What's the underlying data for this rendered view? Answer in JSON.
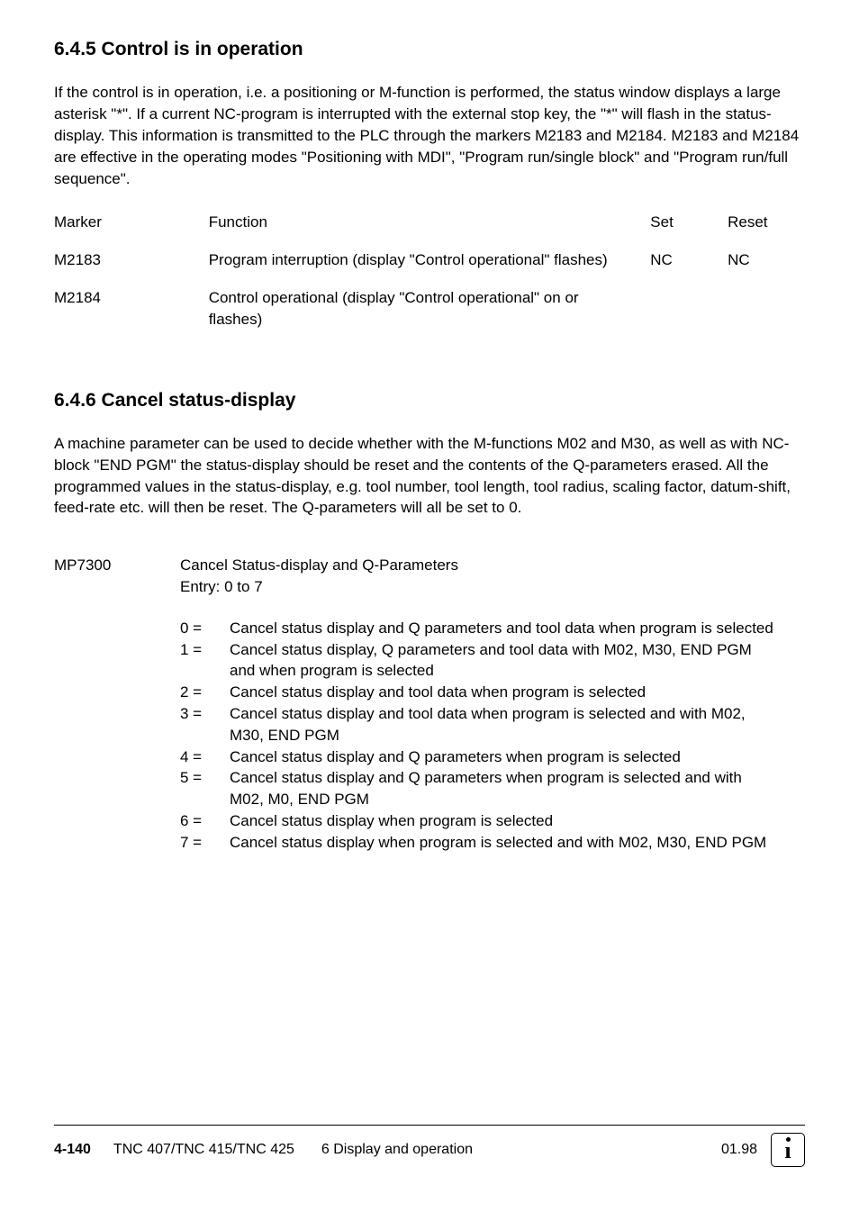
{
  "section1": {
    "heading": "6.4.5  Control is in operation",
    "paragraph": "If the control is in operation, i.e. a positioning or M-function is performed, the status window displays a large asterisk \"*\".  If a current NC-program is interrupted with the external stop key, the \"*\" will flash in the status-display. This information is transmitted to the PLC through the markers M2183 and M2184.  M2183 and M2184 are effective in the operating modes \"Positioning with MDI\", \"Program run/single block\" and \"Program run/full sequence\".",
    "table": {
      "headers": {
        "marker": "Marker",
        "function": "Function",
        "set": "Set",
        "reset": "Reset"
      },
      "rows": [
        {
          "marker": "M2183",
          "function": "Program interruption (display \"Control operational\" flashes)",
          "set": "NC",
          "reset": "NC"
        },
        {
          "marker": "M2184",
          "function": "Control operational (display \"Control operational\" on or flashes)",
          "set": "",
          "reset": ""
        }
      ]
    }
  },
  "section2": {
    "heading": "6.4.6  Cancel status-display",
    "paragraph": "A machine parameter can be used to decide whether with the M-functions M02 and M30, as well as with NC-block \"END PGM\" the status-display should be reset and the contents of the Q-parameters erased. All the programmed values in the status-display, e.g. tool number, tool length, tool radius, scaling factor, datum-shift, feed-rate etc. will then be reset. The Q-parameters will all be set to 0.",
    "mp": {
      "label": "MP7300",
      "title": "Cancel Status-display and Q-Parameters",
      "entry": "Entry: 0 to 7",
      "items": [
        {
          "num": "0 =",
          "desc": "Cancel status display and Q parameters and tool data when program is selected"
        },
        {
          "num": "1 =",
          "desc": "Cancel status display, Q parameters and tool data with M02, M30, END PGM and when program is selected"
        },
        {
          "num": "2 =",
          "desc": "Cancel status display and tool data when program is selected"
        },
        {
          "num": "3 =",
          "desc": "Cancel status display and tool data when program is selected and with M02, M30, END PGM"
        },
        {
          "num": "4 =",
          "desc": "Cancel status display and Q parameters when program is selected"
        },
        {
          "num": "5 =",
          "desc": "Cancel status display and Q parameters when program is selected and with M02, M0, END PGM"
        },
        {
          "num": "6 =",
          "desc": "Cancel status display when program is selected"
        },
        {
          "num": "7 =",
          "desc": "Cancel status display when program is selected and with M02, M30, END PGM"
        }
      ]
    }
  },
  "footer": {
    "page": "4-140",
    "model": "TNC 407/TNC 415/TNC 425",
    "section": "6  Display and operation",
    "date": "01.98"
  }
}
